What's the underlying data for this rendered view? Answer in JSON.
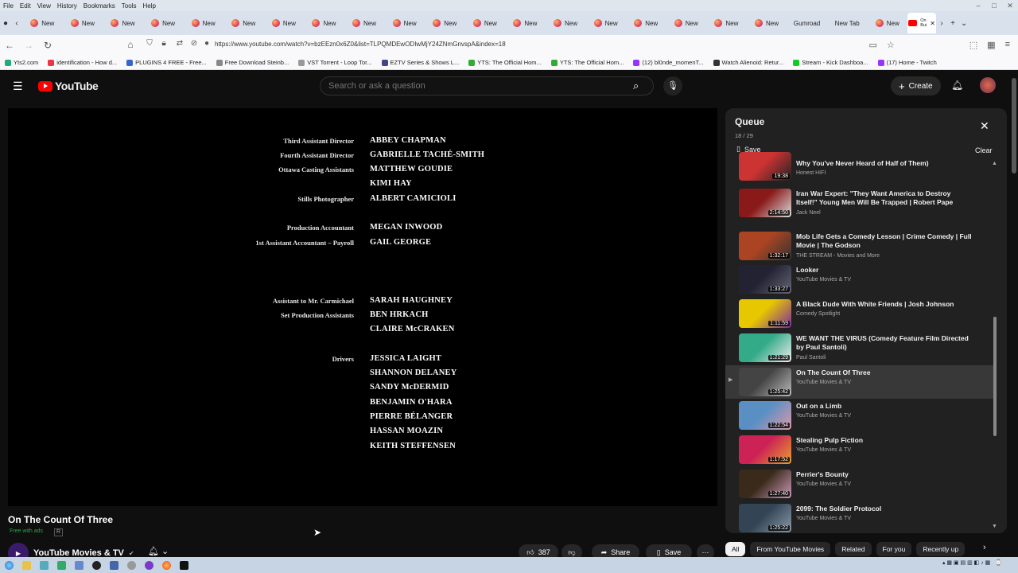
{
  "menubar": {
    "items": [
      "File",
      "Edit",
      "View",
      "History",
      "Bookmarks",
      "Tools",
      "Help"
    ]
  },
  "tabs": [
    {
      "label": "New",
      "icon": "firefox"
    },
    {
      "label": "New",
      "icon": "firefox"
    },
    {
      "label": "New",
      "icon": "firefox"
    },
    {
      "label": "New",
      "icon": "firefox"
    },
    {
      "label": "New",
      "icon": "firefox"
    },
    {
      "label": "New",
      "icon": "firefox"
    },
    {
      "label": "New",
      "icon": "firefox"
    },
    {
      "label": "New",
      "icon": "firefox"
    },
    {
      "label": "New",
      "icon": "firefox"
    },
    {
      "label": "New",
      "icon": "firefox"
    },
    {
      "label": "New",
      "icon": "firefox"
    },
    {
      "label": "New",
      "icon": "firefox"
    },
    {
      "label": "New",
      "icon": "firefox"
    },
    {
      "label": "New",
      "icon": "firefox"
    },
    {
      "label": "New",
      "icon": "firefox"
    },
    {
      "label": "New",
      "icon": "firefox"
    },
    {
      "label": "New",
      "icon": "firefox"
    },
    {
      "label": "New",
      "icon": "firefox"
    },
    {
      "label": "New",
      "icon": "firefox"
    },
    {
      "label": "Gumroad",
      "icon": "none"
    },
    {
      "label": "New Tab",
      "icon": "none"
    },
    {
      "label": "New",
      "icon": "firefox"
    },
    {
      "label": "On\nBui",
      "icon": "youtube",
      "active": true
    }
  ],
  "nav": {
    "url": "https://www.youtube.com/watch?v=bzEEzn0x6Z0&list=TLPQMDEwODIwMjY24ZNmGnvspA&index=18"
  },
  "bookmarks": [
    {
      "label": "Yts2.com",
      "color": "#2a7"
    },
    {
      "label": "identification - How d...",
      "color": "#e34"
    },
    {
      "label": "PLUGINS 4 FREE - Free...",
      "color": "#36c"
    },
    {
      "label": "Free Download Steinb...",
      "color": "#888"
    },
    {
      "label": "VST Torrent - Loop Tor...",
      "color": "#999"
    },
    {
      "label": "EZTV Series & Shows L...",
      "color": "#448"
    },
    {
      "label": "YTS: The Official Hom...",
      "color": "#3a3"
    },
    {
      "label": "YTS: The Official Hom...",
      "color": "#3a3"
    },
    {
      "label": "(12) bl0nde_momenT...",
      "color": "#93f"
    },
    {
      "label": "Watch Alienoid: Retur...",
      "color": "#333"
    },
    {
      "label": "Stream - Kick Dashboa...",
      "color": "#1c2"
    },
    {
      "label": "(17) Home - Twitch",
      "color": "#93f"
    }
  ],
  "header": {
    "logo": "YouTube",
    "search_placeholder": "Search or ask a question",
    "create": "Create"
  },
  "credits": [
    {
      "role": "Third Assistant Director",
      "name": "ABBEY CHAPMAN"
    },
    {
      "role": "Fourth Assistant Director",
      "name": "GABRIELLE TACHÉ-SMITH"
    },
    {
      "role": "Ottawa Casting Assistants",
      "name": "MATTHEW GOUDIE"
    },
    {
      "role": "",
      "name": "KIMI HAY"
    },
    {
      "role": "Stills Photographer",
      "name": "ALBERT CAMICIOLI"
    },
    {
      "role": "Production Accountant",
      "name": "MEGAN INWOOD"
    },
    {
      "role": "1st Assistant Accountant – Payroll",
      "name": "GAIL GEORGE"
    },
    {
      "role": "Assistant to Mr. Carmichael",
      "name": "SARAH HAUGHNEY"
    },
    {
      "role": "Set Production Assistants",
      "name": "BEN HRKACH"
    },
    {
      "role": "",
      "name": "CLAIRE McCRAKEN"
    },
    {
      "role": "Drivers",
      "name": "JESSICA LAIGHT"
    },
    {
      "role": "",
      "name": "SHANNON DELANEY"
    },
    {
      "role": "",
      "name": "SANDY McDERMID"
    },
    {
      "role": "",
      "name": "BENJAMIN O'HARA"
    },
    {
      "role": "",
      "name": "PIERRE BÉLANGER"
    },
    {
      "role": "",
      "name": "HASSAN MOAZIN"
    },
    {
      "role": "",
      "name": "KEITH STEFFENSEN"
    }
  ],
  "video": {
    "title": "On The Count Of Three",
    "free_with_ads": "Free with ads",
    "rating": "R",
    "channel": "YouTube Movies & TV",
    "likes": "387",
    "share": "Share",
    "save": "Save"
  },
  "queue": {
    "title": "Queue",
    "count": "18 / 29",
    "save": "Save",
    "clear": "Clear",
    "items": [
      {
        "title": "Why You've Never Heard of Half of Them)",
        "channel": "Honest HIFI",
        "duration": "19:38",
        "colors": [
          "#c33",
          "#222"
        ]
      },
      {
        "title": "Iran War Expert: \"They Want America to Destroy Itself!\" Young Men Will Be Trapped | Robert Pape",
        "channel": "Jack Neel",
        "duration": "2:14:50",
        "colors": [
          "#8a1a1a",
          "#ddd"
        ]
      },
      {
        "title": "Mob Life Gets a Comedy Lesson | Crime Comedy | Full Movie | The Godson",
        "channel": "THE STREAM - Movies and More",
        "duration": "1:32:17",
        "colors": [
          "#a42",
          "#333"
        ]
      },
      {
        "title": "Looker",
        "channel": "YouTube Movies & TV",
        "duration": "1:33:27",
        "colors": [
          "#223",
          "#667"
        ]
      },
      {
        "title": "A Black Dude With White Friends | Josh Johnson",
        "channel": "Comedy Spotlight",
        "duration": "1:11:59",
        "colors": [
          "#e6c700",
          "#7a2aa0"
        ]
      },
      {
        "title": "WE WANT THE VIRUS (Comedy Feature Film Directed by Paul Santoli)",
        "channel": "Paul Santoli",
        "duration": "1:21:29",
        "colors": [
          "#3a8",
          "#eee"
        ]
      },
      {
        "title": "On The Count Of Three",
        "channel": "YouTube Movies & TV",
        "duration": "1:25:42",
        "colors": [
          "#444",
          "#bbb"
        ],
        "current": true
      },
      {
        "title": "Out on a Limb",
        "channel": "YouTube Movies & TV",
        "duration": "1:22:54",
        "colors": [
          "#5a8fc4",
          "#d9a"
        ]
      },
      {
        "title": "Stealing Pulp Fiction",
        "channel": "YouTube Movies & TV",
        "duration": "1:17:52",
        "colors": [
          "#c25",
          "#e8a030"
        ]
      },
      {
        "title": "Perrier's Bounty",
        "channel": "YouTube Movies & TV",
        "duration": "1:27:40",
        "colors": [
          "#3a2a1a",
          "#c9b"
        ]
      },
      {
        "title": "2099: The Soldier Protocol",
        "channel": "YouTube Movies & TV",
        "duration": "1:25:22",
        "colors": [
          "#345",
          "#89a"
        ]
      }
    ]
  },
  "chips": [
    {
      "label": "All",
      "selected": true
    },
    {
      "label": "From YouTube Movies"
    },
    {
      "label": "Related"
    },
    {
      "label": "For you"
    },
    {
      "label": "Recently up"
    }
  ]
}
